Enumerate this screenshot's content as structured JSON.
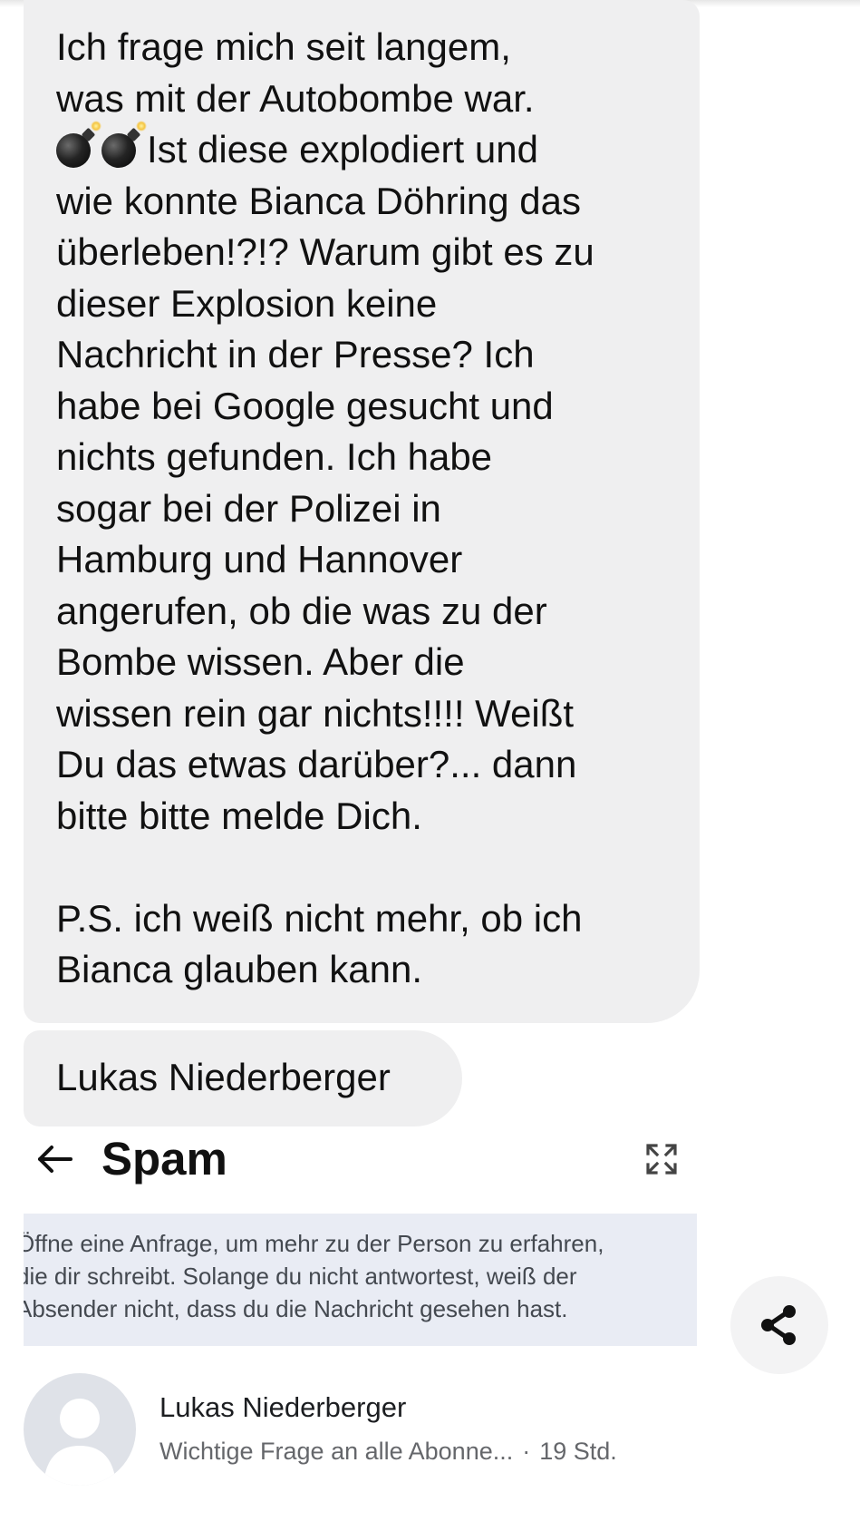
{
  "message": {
    "line1": "Ich frage mich seit langem,\nwas mit der Autobombe war.",
    "emoji_names": [
      "bomb-emoji",
      "bomb-emoji"
    ],
    "line2": "Ist diese explodiert und",
    "line3": "wie konnte Bianca Döhring das\nüberleben!?!? Warum gibt es zu\ndieser Explosion keine\nNachricht in der Presse? Ich\nhabe bei Google gesucht und\nnichts gefunden. Ich habe\nsogar bei der Polizei in\nHamburg und Hannover\nangerufen, ob die was zu der\nBombe wissen. Aber die\nwissen rein gar nichts!!!! Weißt\nDu das etwas darüber?... dann\nbitte bitte melde Dich.\n\nP.S. ich weiß nicht mehr, ob ich\nBianca glauben kann."
  },
  "signature": "Lukas Niederberger",
  "header": {
    "title": "Spam",
    "back_icon": "back-arrow-icon",
    "expand_icon": "expand-icon"
  },
  "info_banner": {
    "text": "Öffne eine Anfrage, um mehr zu der Person zu erfahren,\ndie dir schreibt. Solange du nicht antwortest, weiß der\nAbsender nicht, dass du die Nachricht gesehen hast."
  },
  "share_button": {
    "icon": "share-icon"
  },
  "conversation": {
    "name": "Lukas Niederberger",
    "preview": "Wichtige Frage an alle Abonne...",
    "separator": "·",
    "time": "19 Std."
  },
  "colors": {
    "bubble_bg": "#efeff0",
    "banner_bg": "#e9ecf4",
    "text": "#111111",
    "muted_text": "#65676b"
  }
}
